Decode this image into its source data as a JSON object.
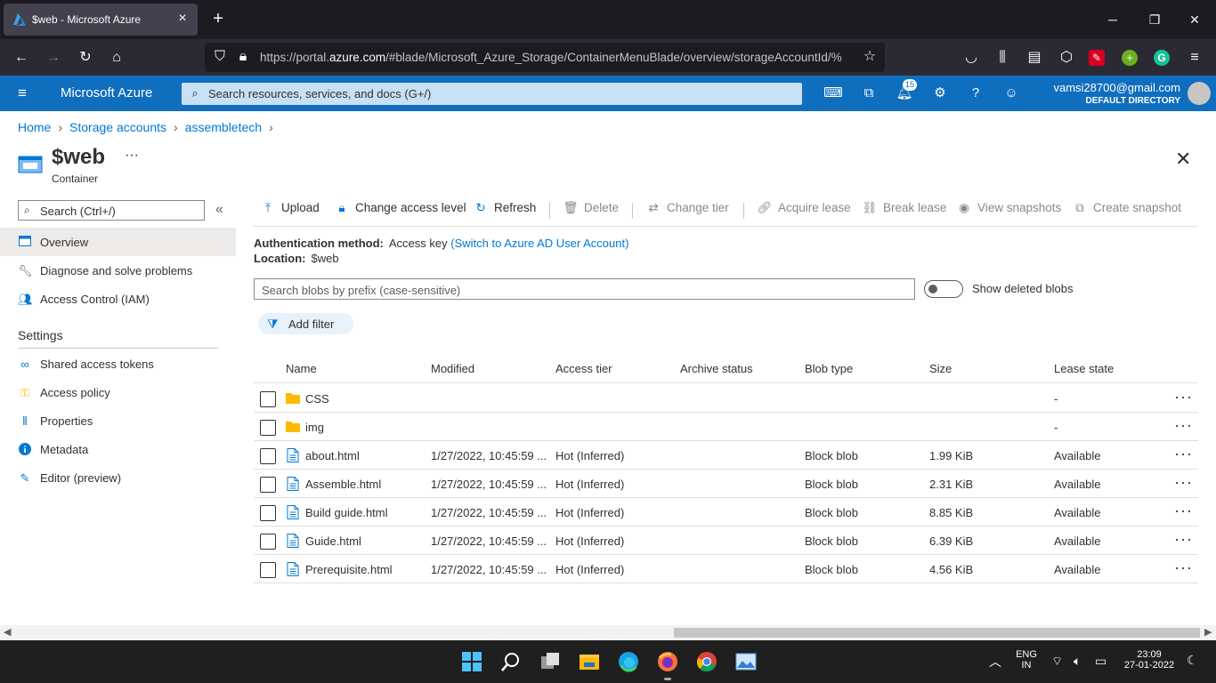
{
  "browser": {
    "tab_title": "$web - Microsoft Azure",
    "url_prefix": "https://portal.",
    "url_domain": "azure.com",
    "url_rest": "/#blade/Microsoft_Azure_Storage/ContainerMenuBlade/overview/storageAccountId/%"
  },
  "azure": {
    "brand": "Microsoft Azure",
    "search_placeholder": "Search resources, services, and docs (G+/)",
    "notification_count": "15",
    "account_email": "vamsi28700@gmail.com",
    "account_directory": "DEFAULT DIRECTORY"
  },
  "breadcrumb": [
    "Home",
    "Storage accounts",
    "assembletech"
  ],
  "page": {
    "title": "$web",
    "subtitle": "Container",
    "more": "···"
  },
  "sidebar": {
    "search_placeholder": "Search (Ctrl+/)",
    "items": [
      {
        "label": "Overview"
      },
      {
        "label": "Diagnose and solve problems"
      },
      {
        "label": "Access Control (IAM)"
      }
    ],
    "settings_header": "Settings",
    "settings_items": [
      {
        "label": "Shared access tokens"
      },
      {
        "label": "Access policy"
      },
      {
        "label": "Properties"
      },
      {
        "label": "Metadata"
      },
      {
        "label": "Editor (preview)"
      }
    ]
  },
  "toolbar": {
    "upload": "Upload",
    "change_access": "Change access level",
    "refresh": "Refresh",
    "delete": "Delete",
    "change_tier": "Change tier",
    "acquire_lease": "Acquire lease",
    "break_lease": "Break lease",
    "view_snapshots": "View snapshots",
    "create_snapshot": "Create snapshot"
  },
  "info": {
    "auth_label": "Authentication method:",
    "auth_value": "Access key",
    "auth_link": "(Switch to Azure AD User Account)",
    "location_label": "Location:",
    "location_value": "$web"
  },
  "blob_search_placeholder": "Search blobs by prefix (case-sensitive)",
  "show_deleted_label": "Show deleted blobs",
  "add_filter_label": "Add filter",
  "table": {
    "headers": [
      "Name",
      "Modified",
      "Access tier",
      "Archive status",
      "Blob type",
      "Size",
      "Lease state"
    ],
    "rows": [
      {
        "type": "folder",
        "name": "CSS",
        "modified": "",
        "tier": "",
        "archive": "",
        "blobtype": "",
        "size": "",
        "lease": "-"
      },
      {
        "type": "folder",
        "name": "img",
        "modified": "",
        "tier": "",
        "archive": "",
        "blobtype": "",
        "size": "",
        "lease": "-"
      },
      {
        "type": "file",
        "name": "about.html",
        "modified": "1/27/2022, 10:45:59 ...",
        "tier": "Hot (Inferred)",
        "archive": "",
        "blobtype": "Block blob",
        "size": "1.99 KiB",
        "lease": "Available"
      },
      {
        "type": "file",
        "name": "Assemble.html",
        "modified": "1/27/2022, 10:45:59 ...",
        "tier": "Hot (Inferred)",
        "archive": "",
        "blobtype": "Block blob",
        "size": "2.31 KiB",
        "lease": "Available"
      },
      {
        "type": "file",
        "name": "Build guide.html",
        "modified": "1/27/2022, 10:45:59 ...",
        "tier": "Hot (Inferred)",
        "archive": "",
        "blobtype": "Block blob",
        "size": "8.85 KiB",
        "lease": "Available"
      },
      {
        "type": "file",
        "name": "Guide.html",
        "modified": "1/27/2022, 10:45:59 ...",
        "tier": "Hot (Inferred)",
        "archive": "",
        "blobtype": "Block blob",
        "size": "6.39 KiB",
        "lease": "Available"
      },
      {
        "type": "file",
        "name": "Prerequisite.html",
        "modified": "1/27/2022, 10:45:59 ...",
        "tier": "Hot (Inferred)",
        "archive": "",
        "blobtype": "Block blob",
        "size": "4.56 KiB",
        "lease": "Available"
      }
    ]
  },
  "taskbar": {
    "lang_top": "ENG",
    "lang_bottom": "IN",
    "time": "23:09",
    "date": "27-01-2022"
  },
  "colors": {
    "azure_blue": "#106ebe",
    "link": "#0078d4",
    "folder": "#ffb900"
  }
}
